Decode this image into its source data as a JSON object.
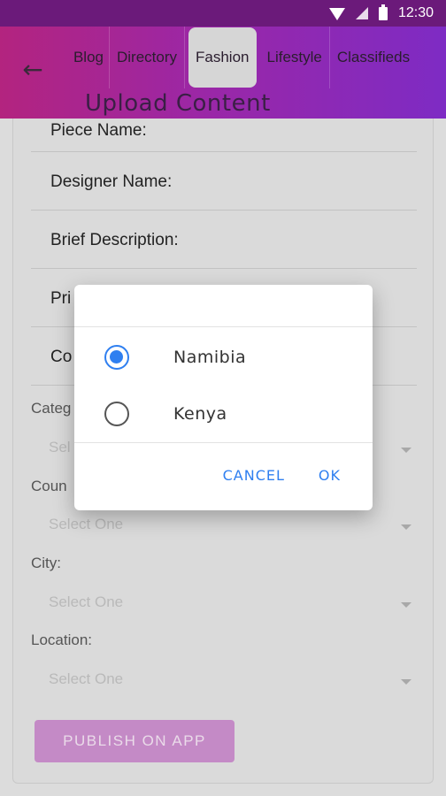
{
  "status_bar": {
    "time": "12:30",
    "icons": [
      "wifi-icon",
      "signal-icon",
      "battery-icon"
    ]
  },
  "app_bar": {
    "back_icon": "arrow-left-icon",
    "tabs": [
      {
        "label": "Blog"
      },
      {
        "label": "Directory"
      },
      {
        "label": "Fashion",
        "active": true
      },
      {
        "label": "Lifestyle"
      },
      {
        "label": "Classifieds"
      }
    ],
    "title": "Upload Content"
  },
  "form": {
    "fields": [
      {
        "label": "Piece Name:"
      },
      {
        "label": "Designer Name:"
      },
      {
        "label": "Brief Description:"
      },
      {
        "label": "Pri"
      },
      {
        "label": "Co"
      }
    ],
    "selects": [
      {
        "label": "Categ",
        "value": "Sel"
      },
      {
        "label": "Coun",
        "value": "Select One"
      },
      {
        "label": "City:",
        "value": "Select One"
      },
      {
        "label": "Location:",
        "value": "Select One"
      }
    ],
    "publish_label": "PUBLISH ON APP"
  },
  "dialog": {
    "options": [
      {
        "label": "Namibia",
        "checked": true
      },
      {
        "label": "Kenya",
        "checked": false
      }
    ],
    "cancel_label": "CANCEL",
    "ok_label": "OK"
  },
  "colors": {
    "accent": "#2f7ff0",
    "gradient_start": "#b3247f",
    "gradient_end": "#7e2bc4"
  }
}
